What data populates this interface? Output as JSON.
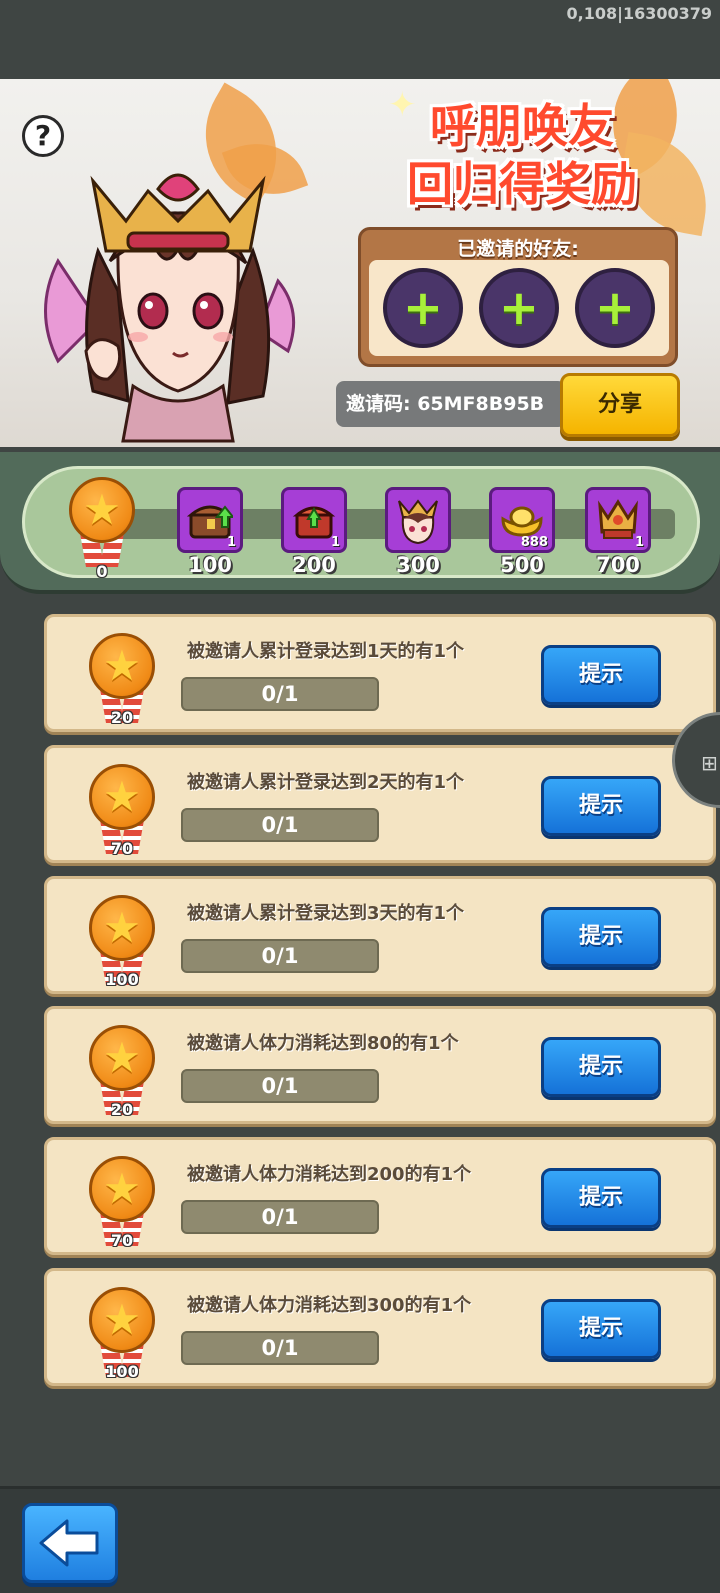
{
  "status_overlay": "0,108|16300379",
  "banner": {
    "title_line1": "呼朋唤友",
    "title_line2": "回归得奖励",
    "invited_label": "已邀请的好友:",
    "invite_code_label": "邀请码: 65MF8B95B",
    "share_label": "分享",
    "help_icon": "question-icon",
    "slot_icon": "plus-icon"
  },
  "progress": {
    "current_points": "0",
    "milestones": [
      {
        "points": "100",
        "reward_icon": "treasure-chest-upgrade-icon",
        "count": "1"
      },
      {
        "points": "200",
        "reward_icon": "red-chest-upgrade-icon",
        "count": "1"
      },
      {
        "points": "300",
        "reward_icon": "hero-portrait-icon",
        "count": ""
      },
      {
        "points": "500",
        "reward_icon": "gold-ingot-icon",
        "count": "888"
      },
      {
        "points": "700",
        "reward_icon": "crown-emblem-icon",
        "count": "1"
      }
    ]
  },
  "tasks": [
    {
      "text": "被邀请人累计登录达到1天的有1个",
      "reward": "20",
      "progress": "0/1",
      "button": "提示"
    },
    {
      "text": "被邀请人累计登录达到2天的有1个",
      "reward": "70",
      "progress": "0/1",
      "button": "提示"
    },
    {
      "text": "被邀请人累计登录达到3天的有1个",
      "reward": "100",
      "progress": "0/1",
      "button": "提示"
    },
    {
      "text": "被邀请人体力消耗达到80的有1个",
      "reward": "20",
      "progress": "0/1",
      "button": "提示"
    },
    {
      "text": "被邀请人体力消耗达到200的有1个",
      "reward": "70",
      "progress": "0/1",
      "button": "提示"
    },
    {
      "text": "被邀请人体力消耗达到300的有1个",
      "reward": "100",
      "progress": "0/1",
      "button": "提示"
    }
  ],
  "colors": {
    "background": "#3f4543",
    "title": "#ff4a2e",
    "hint_button": "#1f86e8",
    "share_button": "#f5b400",
    "slot_fill": "#4a3569"
  }
}
